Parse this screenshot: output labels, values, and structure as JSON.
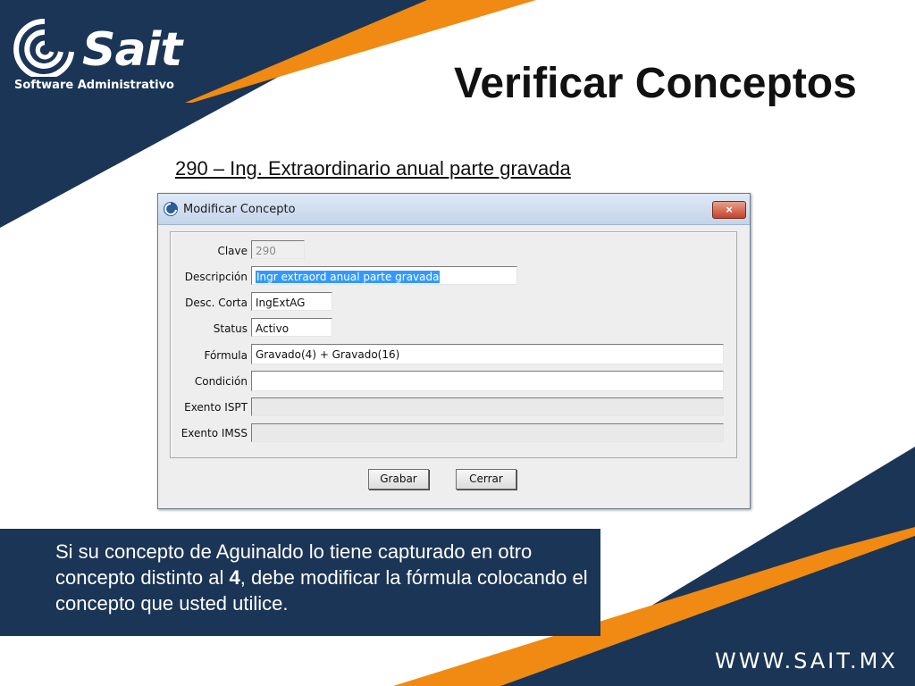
{
  "brand": {
    "name": "Sait",
    "tagline": "Software Administrativo",
    "url": "WWW.SAIT.MX",
    "colors": {
      "navy": "#1b3556",
      "orange": "#f08a12",
      "white": "#ffffff"
    }
  },
  "slide": {
    "title": "Verificar Conceptos",
    "subtitle": "290 – Ing. Extraordinario anual parte gravada"
  },
  "dialog": {
    "title": "Modificar Concepto",
    "close_label": "×",
    "fields": {
      "clave": {
        "label": "Clave",
        "value": "290"
      },
      "descripcion": {
        "label": "Descripción",
        "value": "Ingr extraord anual parte gravada"
      },
      "desc_corta": {
        "label": "Desc. Corta",
        "value": "IngExtAG"
      },
      "status": {
        "label": "Status",
        "value": "Activo"
      },
      "formula": {
        "label": "Fórmula",
        "value": "Gravado(4) + Gravado(16)"
      },
      "condicion": {
        "label": "Condición",
        "value": ""
      },
      "exento_ispt": {
        "label": "Exento ISPT",
        "value": ""
      },
      "exento_imss": {
        "label": "Exento IMSS",
        "value": ""
      }
    },
    "buttons": {
      "save": "Grabar",
      "close": "Cerrar"
    }
  },
  "callout": {
    "text_before": "Si su concepto de Aguinaldo lo tiene capturado en otro concepto distinto al ",
    "text_bold": "4",
    "text_after": ", debe modificar la fórmula colocando el concepto que usted utilice."
  }
}
